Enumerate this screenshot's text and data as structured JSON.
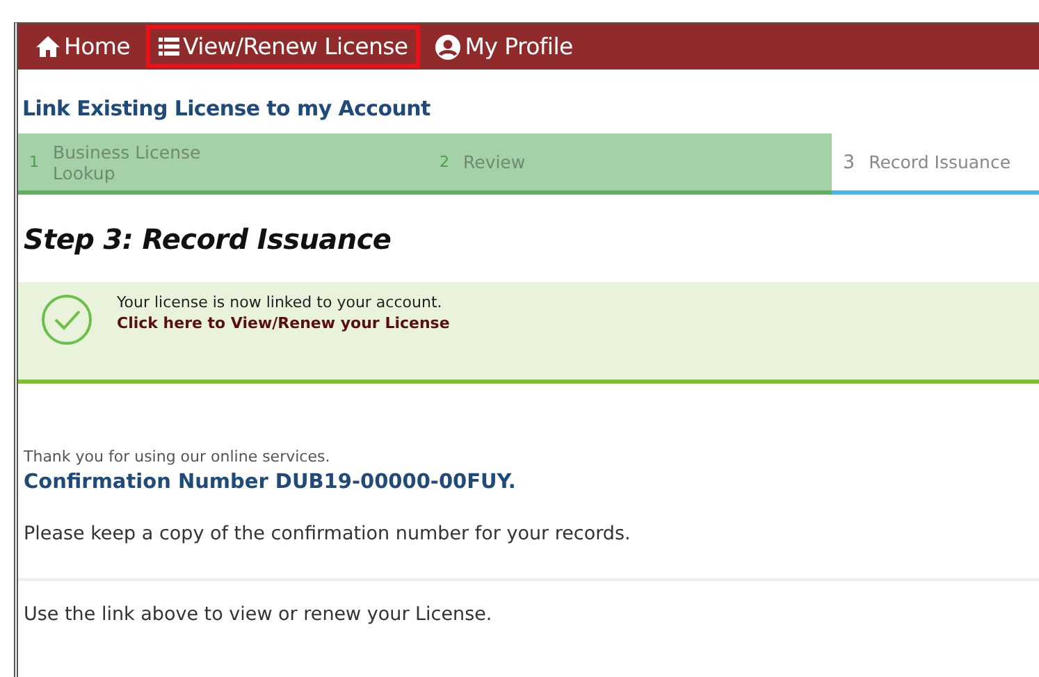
{
  "nav": [
    {
      "label": "Home",
      "highlighted": false
    },
    {
      "label": "View/Renew License",
      "highlighted": true
    },
    {
      "label": "My Profile",
      "highlighted": false
    }
  ],
  "page_title": "Link Existing License to my Account",
  "steps": [
    {
      "number": "1",
      "label": "Business License Lookup",
      "completed": true,
      "selected": false
    },
    {
      "number": "2",
      "label": "Review",
      "completed": true,
      "selected": false
    },
    {
      "number": "3",
      "label": "Record Issuance",
      "completed": false,
      "selected": true
    }
  ],
  "step_heading": "Step 3: Record Issuance",
  "alert": {
    "kind": "success",
    "message": "Your license is now linked to your account.",
    "link": "Click here to View/Renew your License"
  },
  "thank_you": "Thank you for using our online services.",
  "confirmation": "Confirmation Number DUB19-00000-00FUY.",
  "keep_copy": "Please keep a copy of the confirmation number for your records.",
  "use_link": "Use the link above to view or renew your License."
}
